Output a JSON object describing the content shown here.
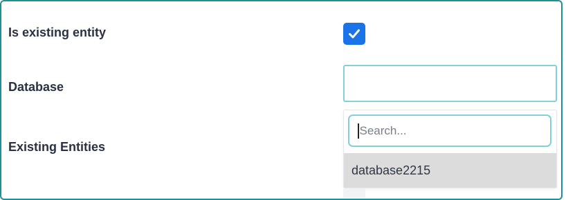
{
  "form": {
    "fields": {
      "is_existing_entity": {
        "label": "Is existing entity",
        "checked": true
      },
      "database": {
        "label": "Database",
        "value": ""
      },
      "existing_entities": {
        "label": "Existing Entities"
      }
    },
    "dropdown": {
      "search_placeholder": "Search...",
      "options": [
        "database2215"
      ]
    }
  },
  "colors": {
    "panel_border": "#1f8f99",
    "checkbox_fill": "#1a73e8",
    "focus_border": "#7fd0d8",
    "option_highlight": "#dcdcdc",
    "label_text": "#2b3142"
  },
  "icons": {
    "checkbox": "checkmark-icon"
  }
}
